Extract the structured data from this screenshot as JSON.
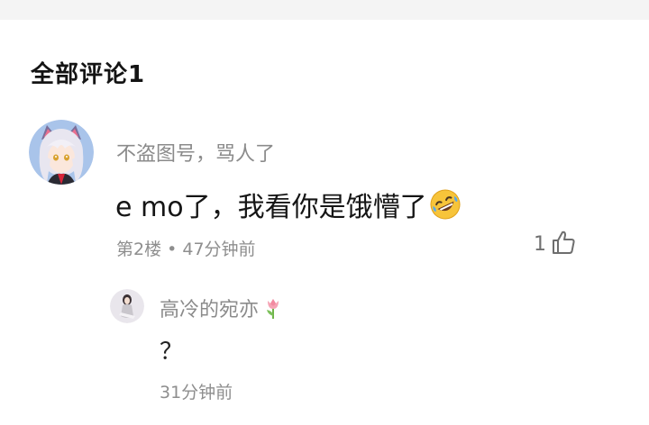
{
  "comments_section": {
    "title": "全部评论1"
  },
  "comment": {
    "username": "不盗图号，骂人了",
    "text": "e mo了，我看你是饿懵了",
    "emoji": "rolling-on-floor-laughing-emoji",
    "meta": "第2楼 • 47分钟前",
    "like_count": "1",
    "like_icon": "thumbs-up-icon"
  },
  "reply": {
    "username": "高冷的宛亦",
    "username_emoji": "tulip-emoji",
    "text": "？",
    "meta": "31分钟前"
  },
  "colors": {
    "background": "#ffffff",
    "top_strip": "#f4f4f4",
    "secondary_text": "#8b8b8b",
    "primary_text": "#151515"
  }
}
